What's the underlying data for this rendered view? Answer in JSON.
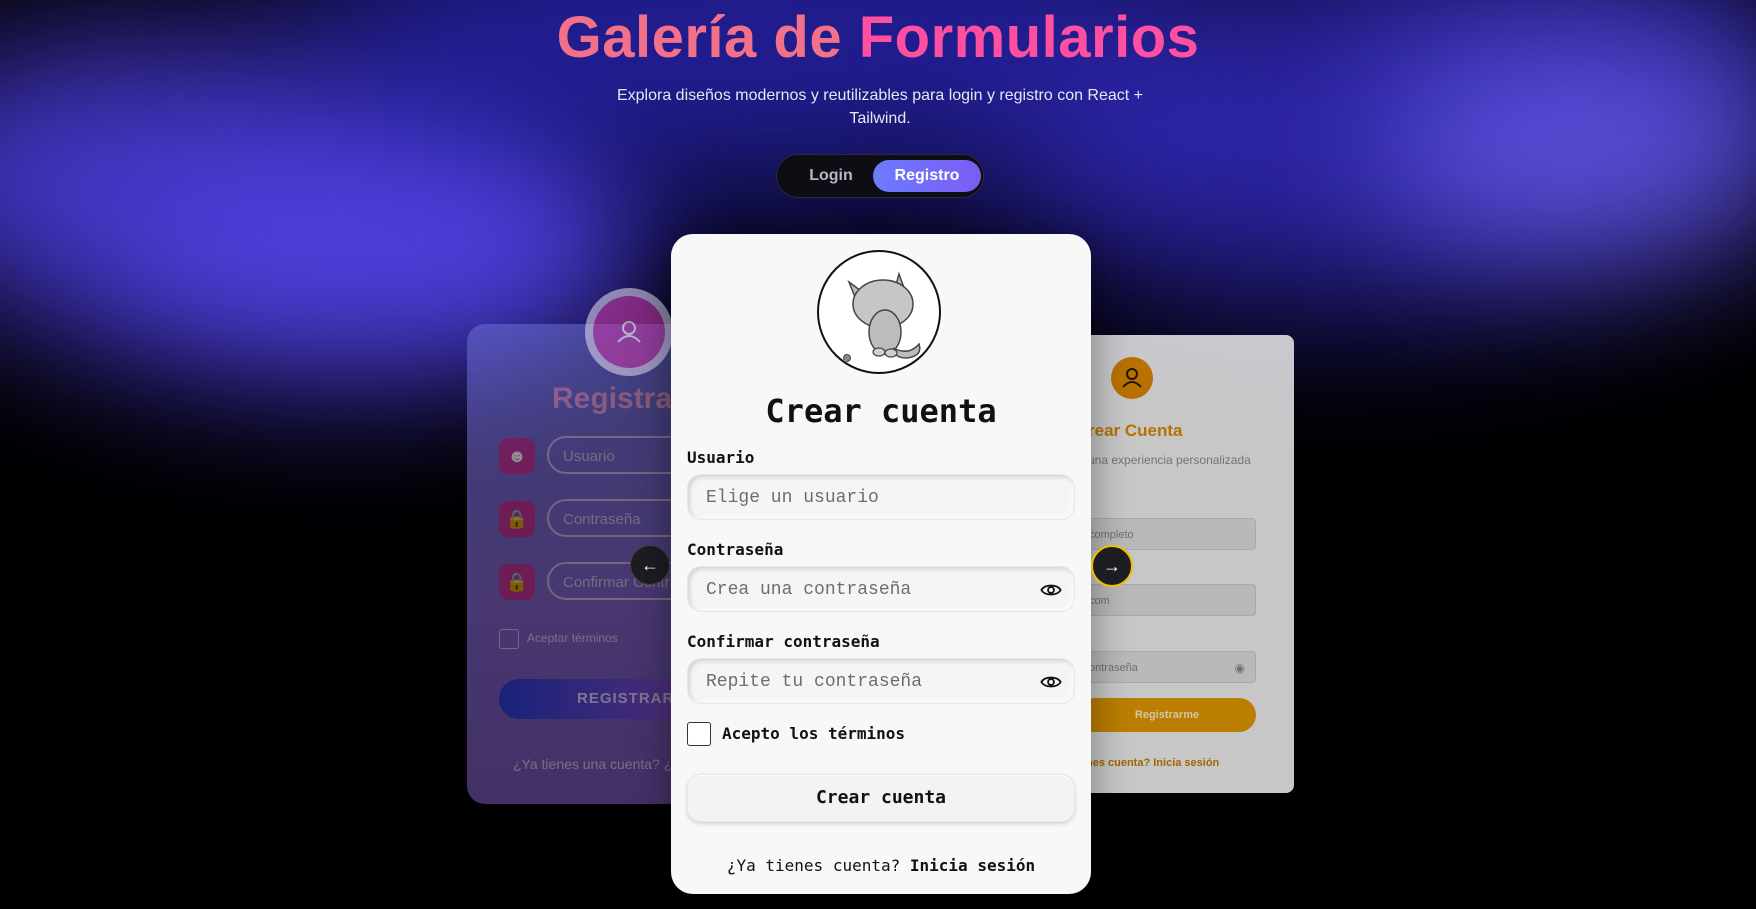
{
  "header": {
    "title_part1": "Galería de",
    "title_part2": "Formularios",
    "subtitle": "Explora diseños modernos y reutilizables para login y registro con React + Tailwind."
  },
  "toggle": {
    "login": "Login",
    "register": "Registro",
    "active": "Registro"
  },
  "left_card": {
    "title": "Registrar",
    "fields": [
      "Usuario",
      "Contraseña",
      "Confirmar Contr"
    ],
    "terms": "Aceptar términos",
    "button": "REGISTRARS",
    "footer": "¿Ya tienes una cuenta? ¿In"
  },
  "main_card": {
    "title": "Crear cuenta",
    "user_label": "Usuario",
    "user_placeholder": "Elige un usuario",
    "pass_label": "Contraseña",
    "pass_placeholder": "Crea una contraseña",
    "confirm_label": "Confirmar contraseña",
    "confirm_placeholder": "Repite tu contraseña",
    "terms": "Acepto los términos",
    "button": "Crear cuenta",
    "footer_text": "¿Ya tienes cuenta?",
    "footer_link": "Inicia sesión"
  },
  "right_card": {
    "title": "rear Cuenta",
    "subtitle": "una experiencia personalizada",
    "fields": [
      "completo",
      "com",
      "ontraseña"
    ],
    "button": "Registrarme",
    "footer": "nes cuenta? Inicia sesión"
  },
  "nav": {
    "prev": "←",
    "next": "→"
  },
  "colors": {
    "accent_pink": "#ff4fa1",
    "accent_salmon": "#f37188",
    "toggle_active": "#6b7bff",
    "right_accent": "#e08a00"
  }
}
